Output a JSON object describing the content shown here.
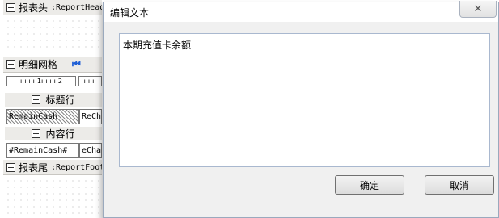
{
  "designer": {
    "report_header": {
      "prefix": "报表头",
      "tag": ":ReportHead"
    },
    "detail_grid": {
      "label": "明细网格",
      "nav_icon": "first-record-icon"
    },
    "ruler": {
      "seg1": "1",
      "seg2": "2"
    },
    "title_row": {
      "label": "标题行",
      "cell1": "RemainCash",
      "cell2": "ReCh"
    },
    "content_row": {
      "label": "内容行",
      "cell1": "#RemainCash#",
      "cell2": "eCha"
    },
    "report_footer": {
      "prefix": "报表尾",
      "tag": ":ReportFoot"
    }
  },
  "dialog": {
    "title": "编辑文本",
    "text": "本期充值卡余额",
    "ok_label": "确定",
    "cancel_label": "取消",
    "close_icon": "close-icon"
  }
}
